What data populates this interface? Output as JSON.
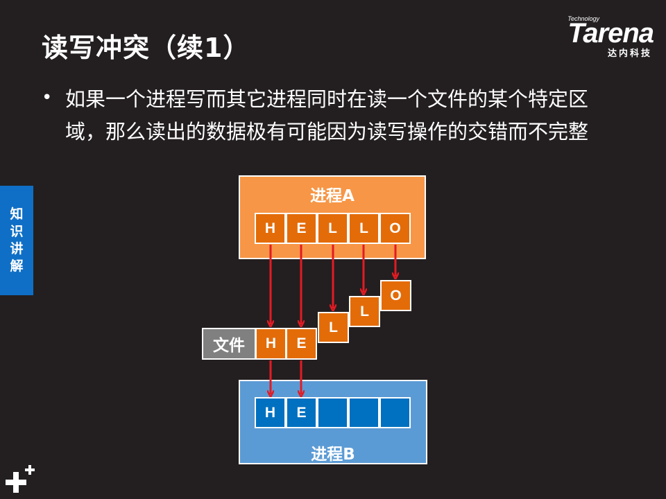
{
  "slide": {
    "title": "读写冲突（续1）",
    "bullet": "如果一个进程写而其它进程同时在读一个文件的某个特定区域，那么读出的数据极有可能因为读写操作的交错而不完整",
    "side_tab": [
      "知",
      "识",
      "讲",
      "解"
    ]
  },
  "logo": {
    "technology": "Technology",
    "word": "Tarena",
    "cn": "达内科技"
  },
  "diagram": {
    "process_a": {
      "label": "进程A",
      "cells": [
        "H",
        "E",
        "L",
        "L",
        "O"
      ]
    },
    "file": {
      "label": "文件",
      "written": [
        "H",
        "E"
      ],
      "in_flight": [
        "L",
        "L",
        "O"
      ]
    },
    "process_b": {
      "label": "进程B",
      "cells": [
        "H",
        "E",
        "",
        "",
        ""
      ]
    },
    "colors": {
      "process_a_bg": "#f79646",
      "cell_orange": "#e36c09",
      "process_b_bg": "#5b9bd5",
      "cell_blue": "#0070c0",
      "arrow": "#e31b23",
      "tab": "#0f6fc6"
    }
  }
}
